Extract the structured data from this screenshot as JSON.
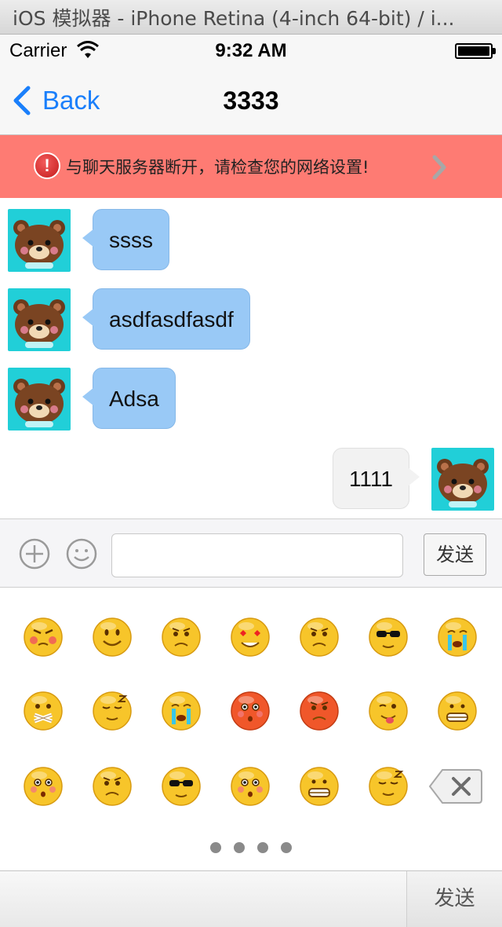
{
  "simulator": {
    "title": "iOS 模拟器 - iPhone Retina (4-inch 64-bit) / i..."
  },
  "status_bar": {
    "carrier": "Carrier",
    "time": "9:32 AM"
  },
  "nav": {
    "back_label": "Back",
    "title": "3333"
  },
  "banner": {
    "message": "与聊天服务器断开，请检查您的网络设置!",
    "icon": "!"
  },
  "messages": [
    {
      "side": "incoming",
      "text": "ssss"
    },
    {
      "side": "incoming",
      "text": "asdfasdfasdf"
    },
    {
      "side": "incoming",
      "text": "Adsa"
    },
    {
      "side": "outgoing",
      "text": "1111"
    }
  ],
  "toolbar": {
    "input_value": "",
    "send_label": "发送"
  },
  "emoji_keyboard": {
    "emojis": [
      "angry-blush",
      "smile",
      "worried",
      "heart-eyes",
      "annoyed",
      "sunglasses",
      "crying",
      "silenced",
      "sleepy",
      "sweat-crying",
      "flushed-red",
      "furious",
      "tongue-wink",
      "big-grin",
      "surprised-cover",
      "sad",
      "masked-cool",
      "shy-blush",
      "grimacing",
      "dizzy-drool"
    ],
    "page_count": 4,
    "delete_icon": "backspace-icon"
  },
  "bottom_bar": {
    "send_label": "发送"
  },
  "colors": {
    "ios_blue": "#1a7ffb",
    "banner_red": "#fe7b73",
    "incoming_bubble": "#99c9f6",
    "outgoing_bubble": "#f2f2f2",
    "avatar_bg": "#21cfd8",
    "emoji_yellow": "#f7c52a"
  }
}
